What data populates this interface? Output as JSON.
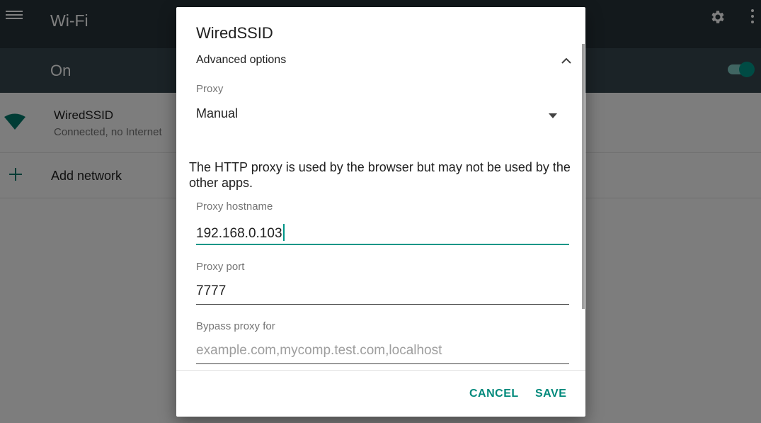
{
  "app": {
    "title": "Wi-Fi",
    "toggle_label": "On",
    "toggle_on": true,
    "accent_color": "#009688"
  },
  "networks": [
    {
      "name": "WiredSSID",
      "status": "Connected, no Internet",
      "icon": "wifi-icon"
    }
  ],
  "add_network": {
    "label": "Add network",
    "icon": "plus-icon"
  },
  "dialog": {
    "title": "WiredSSID",
    "advanced_label": "Advanced options",
    "proxy_label": "Proxy",
    "proxy_value": "Manual",
    "info_text": "The HTTP proxy is used by the browser but may not be used by the other apps.",
    "hostname_label": "Proxy hostname",
    "hostname_value": "192.168.0.103",
    "port_label": "Proxy port",
    "port_value": "7777",
    "bypass_label": "Bypass proxy for",
    "bypass_placeholder": "example.com,mycomp.test.com,localhost",
    "cancel_label": "CANCEL",
    "save_label": "SAVE"
  }
}
